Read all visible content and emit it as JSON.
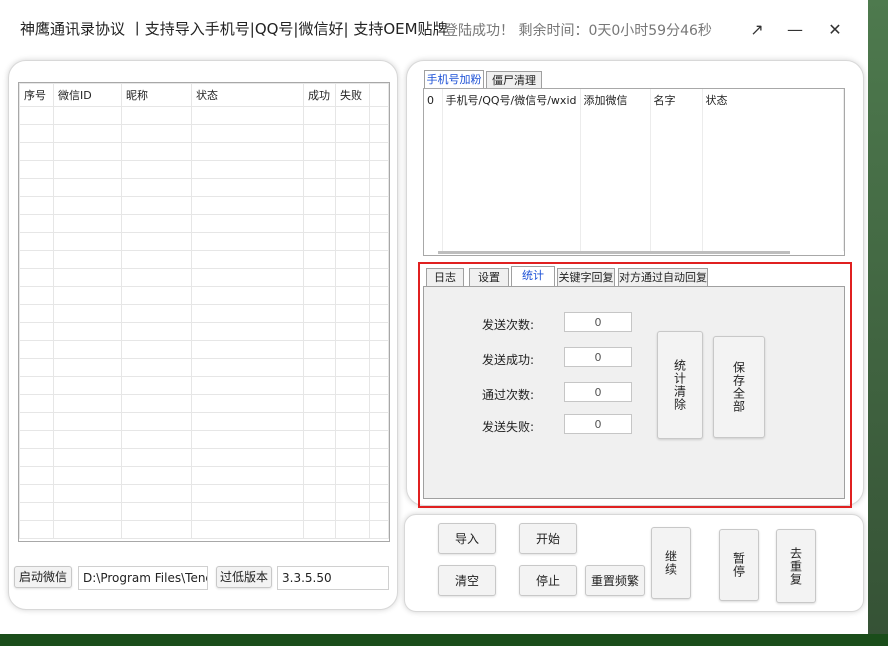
{
  "titlebar": {
    "title": "神鹰通讯录协议 丨支持导入手机号|QQ号|微信好| 支持OEM贴牌",
    "status": "登陆成功！ 剩余时间：0天0小时59分46秒",
    "expand": "↗",
    "minimize": "—",
    "close": "✕"
  },
  "left_table": {
    "headers": [
      "序号",
      "微信ID",
      "昵称",
      "状态",
      "成功",
      "失败"
    ]
  },
  "left_bottom": {
    "start_wechat": "启动微信",
    "path": "D:\\Program Files\\Tencent",
    "low_version": "过低版本",
    "version": "3.3.5.50"
  },
  "top_tabs": [
    "手机号加粉",
    "僵尸清理"
  ],
  "right_table": {
    "headers": [
      "0",
      "手机号/QQ号/微信号/wxid",
      "添加微信",
      "名字",
      "状态"
    ]
  },
  "sub_tabs": [
    "日志",
    "设置",
    "统计",
    "关键字回复",
    "对方通过自动回复"
  ],
  "stats": {
    "send_count_label": "发送次数:",
    "send_count": "0",
    "send_success_label": "发送成功:",
    "send_success": "0",
    "pass_count_label": "通过次数:",
    "pass_count": "0",
    "send_fail_label": "发送失败:",
    "send_fail": "0",
    "clear_stats": "统计清除",
    "save_all": "保存全部"
  },
  "bottom_buttons": {
    "import": "导入",
    "start": "开始",
    "clear": "清空",
    "stop": "停止",
    "reset_freq": "重置频繁",
    "resume": "继续",
    "pause": "暂停",
    "dedupe": "去重复"
  },
  "colors": {
    "highlight": "#e02020",
    "active_tab": "#1a4fd6"
  }
}
